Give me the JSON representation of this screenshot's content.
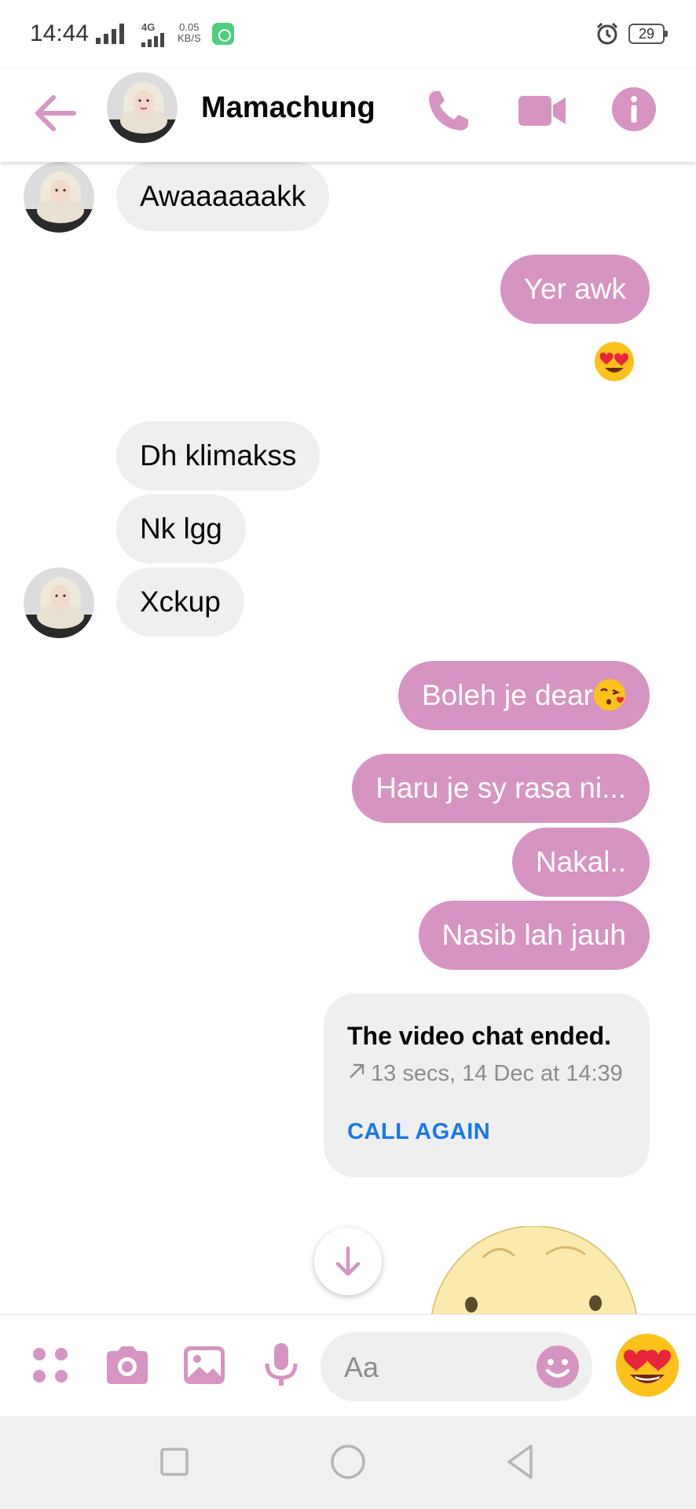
{
  "status_bar": {
    "time": "14:44",
    "network": "4G",
    "speed_value": "0.05",
    "speed_unit": "KB/S",
    "battery": "29"
  },
  "header": {
    "contact_name": "Mamachung",
    "accent_color": "#d694c2"
  },
  "messages": [
    {
      "side": "in",
      "text": "Awaaaaaakk"
    },
    {
      "side": "out",
      "text": "Yer awk",
      "reaction": "heart-eyes"
    },
    {
      "side": "in",
      "text": "Dh klimakss"
    },
    {
      "side": "in",
      "text": "Nk lgg"
    },
    {
      "side": "in",
      "text": "Xckup"
    },
    {
      "side": "out",
      "text": "Boleh je dear",
      "emoji": "kissing-heart"
    },
    {
      "side": "out",
      "text": "Haru je sy rasa ni..."
    },
    {
      "side": "out",
      "text": "Nakal.."
    },
    {
      "side": "out",
      "text": "Nasib lah jauh"
    }
  ],
  "call_card": {
    "title": "The video chat ended.",
    "meta": "13 secs, 14 Dec at 14:39",
    "action": "CALL AGAIN"
  },
  "composer": {
    "placeholder": "Aa",
    "like_emoji": "heart-eyes"
  }
}
